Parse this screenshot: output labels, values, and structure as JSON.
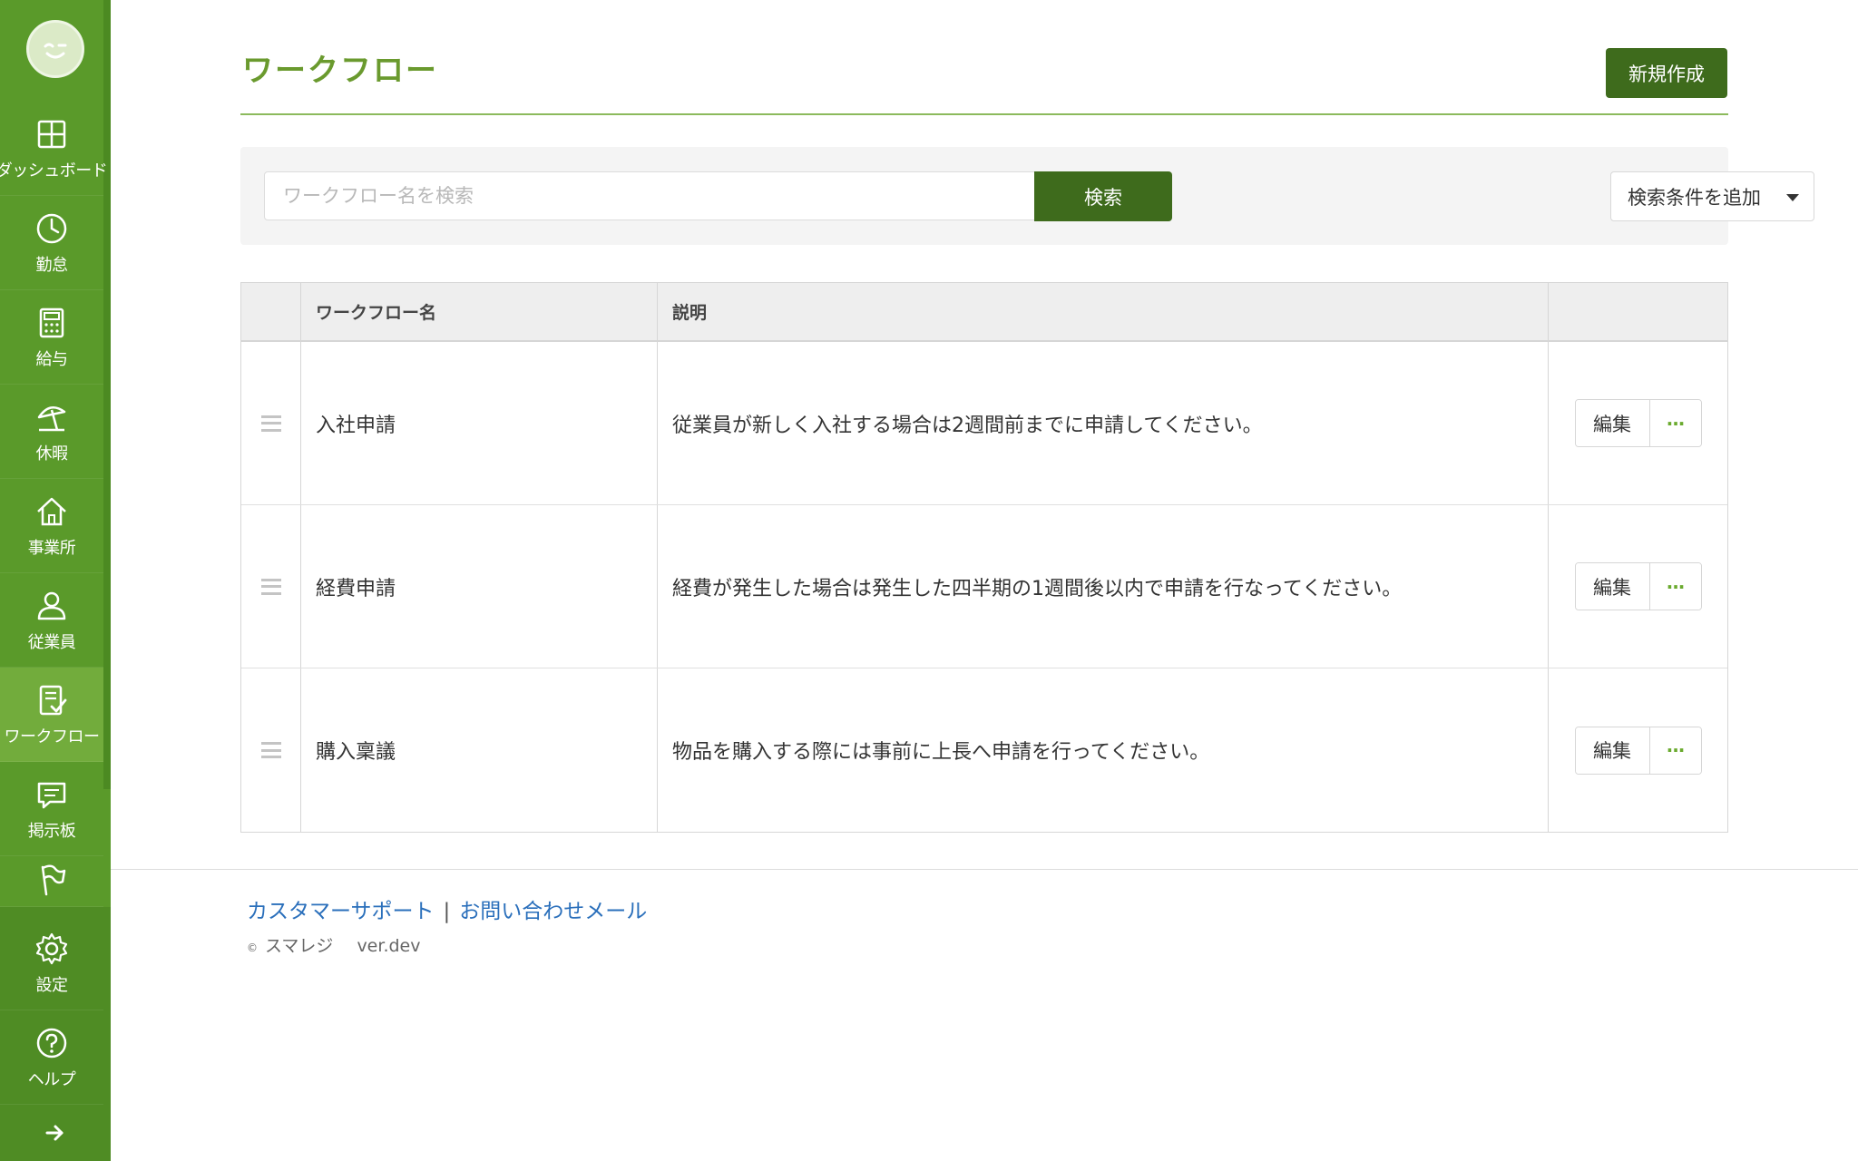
{
  "sidebar": {
    "items": [
      {
        "label": "ダッシュボード",
        "icon": "dashboard-icon"
      },
      {
        "label": "勤怠",
        "icon": "clock-icon"
      },
      {
        "label": "給与",
        "icon": "calculator-icon"
      },
      {
        "label": "休暇",
        "icon": "beach-umbrella-icon"
      },
      {
        "label": "事業所",
        "icon": "home-icon"
      },
      {
        "label": "従業員",
        "icon": "person-icon"
      },
      {
        "label": "ワークフロー",
        "icon": "checklist-icon",
        "active": true
      },
      {
        "label": "掲示板",
        "icon": "chat-icon"
      },
      {
        "label": "",
        "icon": "flag-icon"
      },
      {
        "label": "設定",
        "icon": "gear-icon"
      },
      {
        "label": "ヘルプ",
        "icon": "help-icon"
      }
    ],
    "expand_icon": "arrow-right-icon",
    "colors": {
      "background": "#5a9a2a",
      "active": "#72ac3c"
    }
  },
  "header": {
    "title": "ワークフロー",
    "new_button": "新規作成"
  },
  "search": {
    "placeholder": "ワークフロー名を検索",
    "value": "",
    "button": "検索",
    "filter_dropdown": "検索条件を追加"
  },
  "table": {
    "columns": [
      "",
      "ワークフロー名",
      "説明",
      ""
    ],
    "rows": [
      {
        "name": "入社申請",
        "description": "従業員が新しく入社する場合は2週間前までに申請してください。",
        "edit": "編集",
        "more": "···"
      },
      {
        "name": "経費申請",
        "description": "経費が発生した場合は発生した四半期の1週間後以内で申請を行なってください。",
        "edit": "編集",
        "more": "···"
      },
      {
        "name": "購入稟議",
        "description": "物品を購入する際には事前に上長へ申請を行ってください。",
        "edit": "編集",
        "more": "···"
      }
    ]
  },
  "footer": {
    "support_link": "カスタマーサポート",
    "separator": "|",
    "contact_link": "お問い合わせメール",
    "copyright_mark": "©",
    "company": "スマレジ",
    "version": "ver.dev"
  },
  "colors": {
    "accent": "#3e6b1c",
    "title_green": "#6a9a2e",
    "link_blue": "#2a6fbb"
  }
}
